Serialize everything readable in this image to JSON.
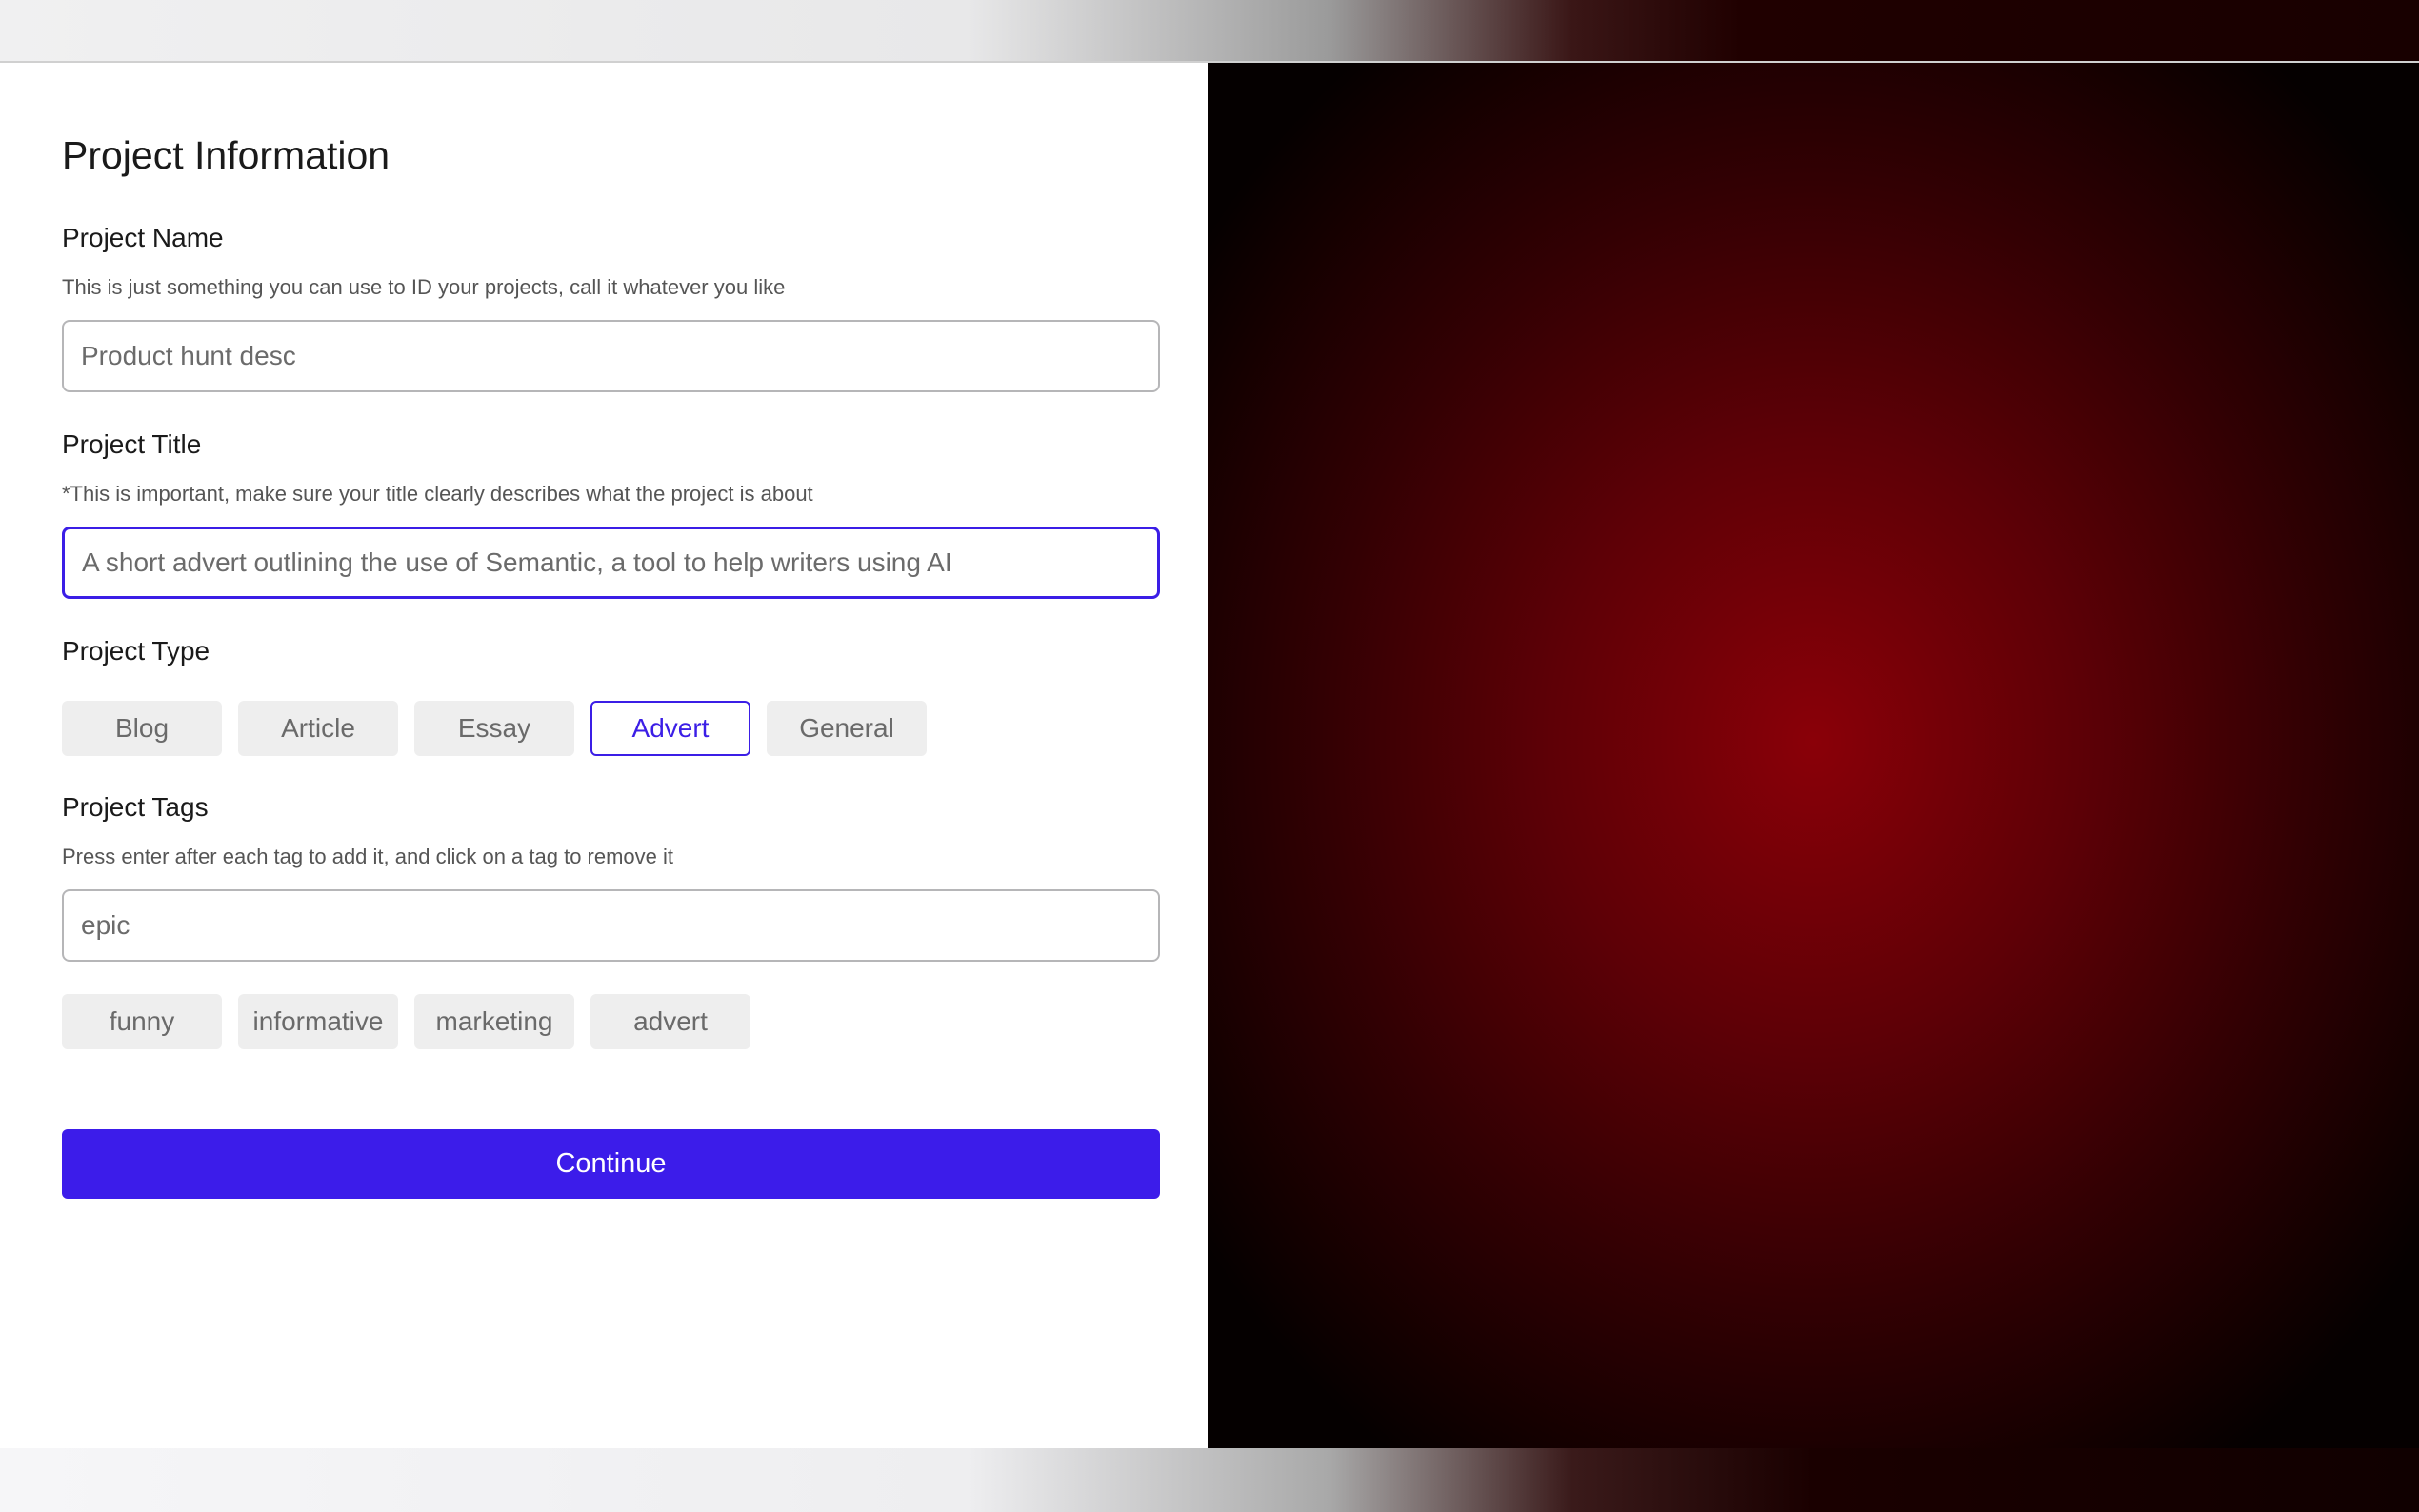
{
  "form": {
    "title": "Project Information",
    "project_name": {
      "label": "Project Name",
      "help": "This is just something you can use to ID your projects, call it whatever you like",
      "value": "Product hunt desc"
    },
    "project_title": {
      "label": "Project Title",
      "help": "*This is important, make sure your title clearly describes what the project is about",
      "value": "A short advert outlining the use of Semantic, a tool to help writers using AI"
    },
    "project_type": {
      "label": "Project Type",
      "options": [
        "Blog",
        "Article",
        "Essay",
        "Advert",
        "General"
      ],
      "selected": "Advert"
    },
    "project_tags": {
      "label": "Project Tags",
      "help": "Press enter after each tag to add it, and click on a tag to remove it",
      "input_value": "epic",
      "tags": [
        "funny",
        "informative",
        "marketing",
        "advert"
      ]
    },
    "continue_label": "Continue"
  },
  "colors": {
    "accent": "#3c1cea",
    "chip_bg": "#eeeeee",
    "art_center": "#8a0008"
  }
}
